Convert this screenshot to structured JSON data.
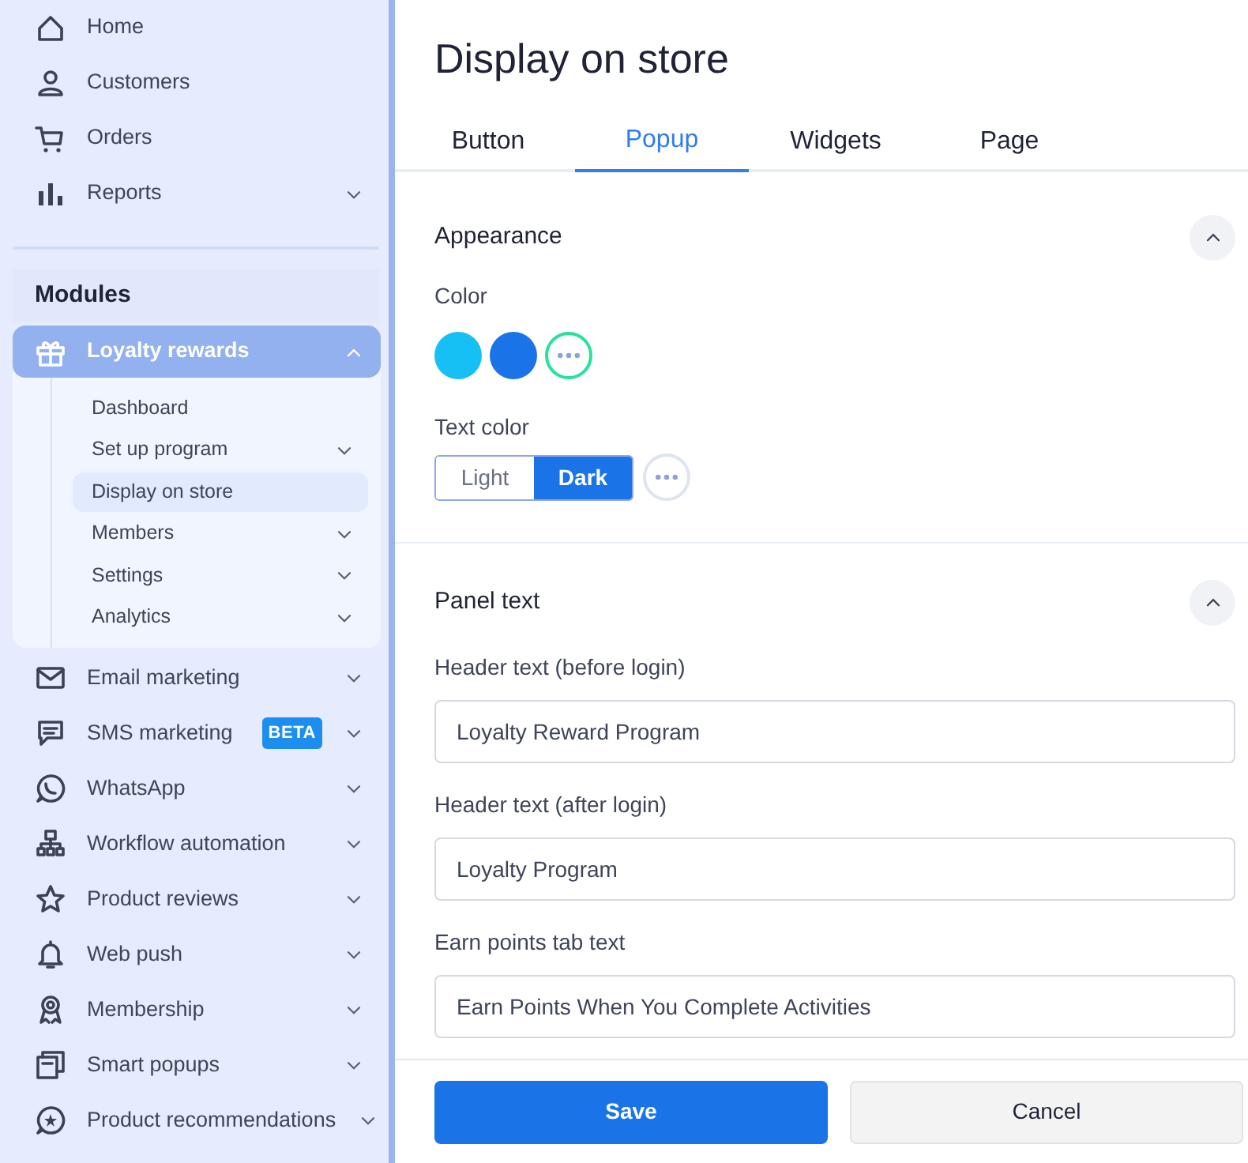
{
  "sidebar": {
    "top_items": [
      {
        "label": "Home",
        "has_chevron": false
      },
      {
        "label": "Customers",
        "has_chevron": false
      },
      {
        "label": "Orders",
        "has_chevron": false
      },
      {
        "label": "Reports",
        "has_chevron": true
      }
    ],
    "section_title": "Modules",
    "modules": [
      {
        "label": "Loyalty rewards",
        "has_chevron": true,
        "expanded": true,
        "children": [
          {
            "label": "Dashboard",
            "has_chevron": false,
            "selected": false
          },
          {
            "label": "Set up program",
            "has_chevron": true,
            "selected": false
          },
          {
            "label": "Display on store",
            "has_chevron": false,
            "selected": true
          },
          {
            "label": "Members",
            "has_chevron": true,
            "selected": false
          },
          {
            "label": "Settings",
            "has_chevron": true,
            "selected": false
          },
          {
            "label": "Analytics",
            "has_chevron": true,
            "selected": false
          }
        ]
      },
      {
        "label": "Email marketing",
        "has_chevron": true
      },
      {
        "label": "SMS marketing",
        "has_chevron": true,
        "badge": "BETA"
      },
      {
        "label": "WhatsApp",
        "has_chevron": true
      },
      {
        "label": "Workflow automation",
        "has_chevron": true
      },
      {
        "label": "Product reviews",
        "has_chevron": true
      },
      {
        "label": "Web push",
        "has_chevron": true
      },
      {
        "label": "Membership",
        "has_chevron": true
      },
      {
        "label": "Smart popups",
        "has_chevron": true
      },
      {
        "label": "Product recommendations",
        "has_chevron": true
      }
    ]
  },
  "page": {
    "title": "Display on store",
    "tabs": [
      {
        "label": "Button",
        "selected": false
      },
      {
        "label": "Popup",
        "selected": true
      },
      {
        "label": "Widgets",
        "selected": false
      },
      {
        "label": "Page",
        "selected": false
      }
    ],
    "sections": [
      {
        "title": "Appearance",
        "expanded": true,
        "fields": [
          {
            "kind": "swatches",
            "label": "Color",
            "options": [
              {
                "kind": "swatch",
                "color": "#16c0f5",
                "selected": false
              },
              {
                "kind": "swatch",
                "color": "#1b73e8",
                "selected": false
              },
              {
                "kind": "more",
                "selected": true
              }
            ]
          },
          {
            "kind": "segmented",
            "label": "Text color",
            "options": [
              {
                "kind": "segment",
                "label": "Light",
                "selected": false
              },
              {
                "kind": "segment",
                "label": "Dark",
                "selected": true
              },
              {
                "kind": "more",
                "selected": false
              }
            ]
          }
        ]
      },
      {
        "title": "Panel text",
        "expanded": true,
        "fields": [
          {
            "kind": "text",
            "label": "Header text (before login)",
            "value": "Loyalty Reward Program"
          },
          {
            "kind": "text",
            "label": "Header text (after login)",
            "value": "Loyalty Program"
          },
          {
            "kind": "text",
            "label": "Earn points tab text",
            "value": "Earn Points When You Complete Activities"
          }
        ]
      }
    ]
  },
  "footer": {
    "save": "Save",
    "cancel": "Cancel"
  }
}
